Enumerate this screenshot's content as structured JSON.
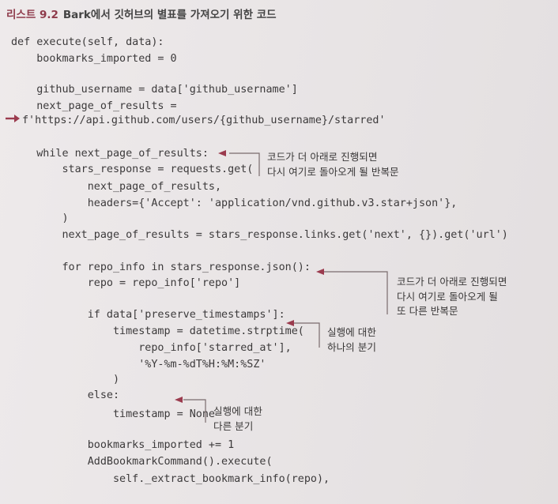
{
  "caption": {
    "number": "리스트 9.2",
    "title": "Bark에서 깃허브의 별표를 가져오기 위한 코드"
  },
  "code_lines": [
    "def execute(self, data):",
    "    bookmarks_imported = 0",
    "",
    "    github_username = data['github_username']",
    "    next_page_of_results =",
    "f'https://api.github.com/users/{github_username}/starred'",
    "",
    "    while next_page_of_results:",
    "        stars_response = requests.get(",
    "            next_page_of_results,",
    "            headers={'Accept': 'application/vnd.github.v3.star+json'},",
    "        )",
    "        next_page_of_results = stars_response.links.get('next', {}).get('url')",
    "",
    "        for repo_info in stars_response.json():",
    "            repo = repo_info['repo']",
    "",
    "            if data['preserve_timestamps']:",
    "                timestamp = datetime.strptime(",
    "                    repo_info['starred_at'],",
    "                    '%Y-%m-%dT%H:%M:%SZ'",
    "                )",
    "            else:",
    "                timestamp = None",
    "",
    "            bookmarks_imported += 1",
    "            AddBookmarkCommand().execute(",
    "                self._extract_bookmark_info(repo),"
  ],
  "annotations": [
    {
      "lines": [
        "코드가 더 아래로 진행되면",
        "다시 여기로 돌아오게 될 반복문"
      ]
    },
    {
      "lines": [
        "코드가 더 아래로 진행되면",
        "다시 여기로 돌아오게 될",
        "또 다른 반복문"
      ]
    },
    {
      "lines": [
        "실행에 대한",
        "하나의 분기"
      ]
    },
    {
      "lines": [
        "실행에 대한",
        "다른 분기"
      ]
    }
  ],
  "colors": {
    "accent": "#9b3b4e",
    "text": "#3c3a3b"
  }
}
